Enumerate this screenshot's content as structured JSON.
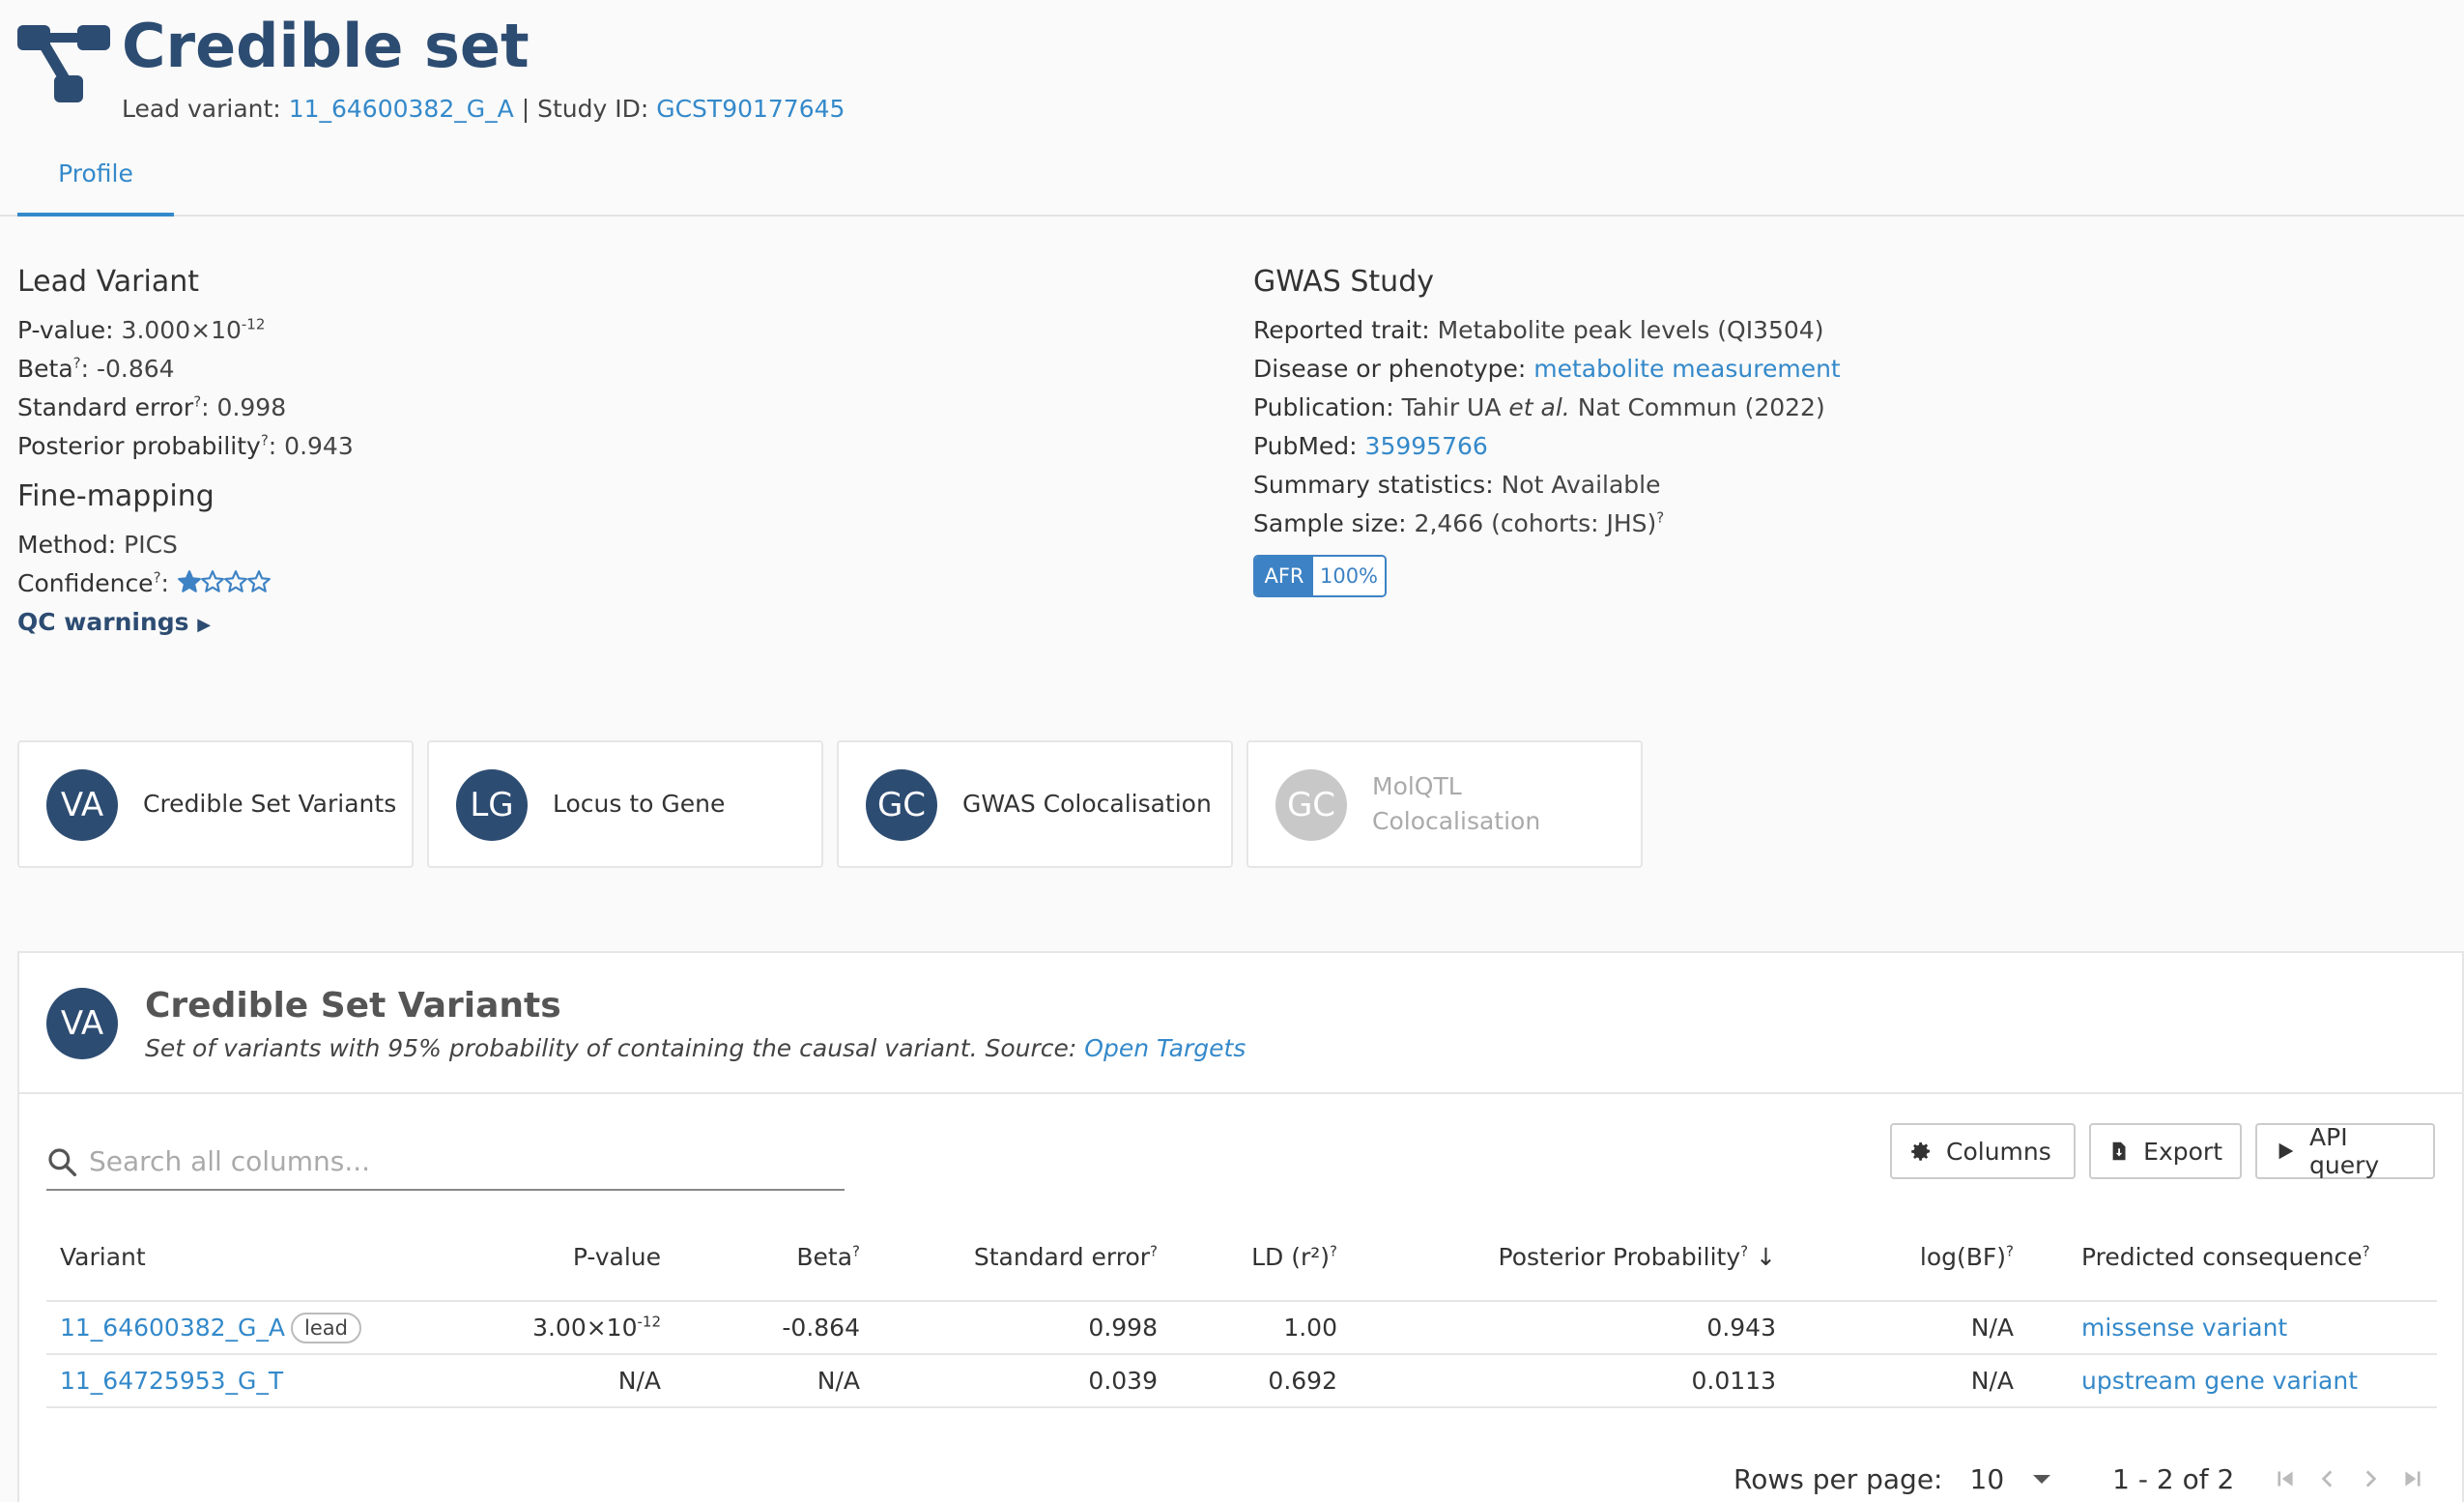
{
  "header": {
    "title": "Credible set",
    "lead_variant_label": "Lead variant:",
    "lead_variant": "11_64600382_G_A",
    "study_id_label": "Study ID:",
    "study_id": "GCST90177645"
  },
  "tabs": [
    {
      "label": "Profile"
    }
  ],
  "lead_variant_section": {
    "title": "Lead Variant",
    "pvalue_label": "P-value:",
    "pvalue_mantissa": "3.000×10",
    "pvalue_exponent": "-12",
    "beta_label": "Beta",
    "beta": "-0.864",
    "se_label": "Standard error",
    "se": "0.998",
    "pp_label": "Posterior probability",
    "pp": "0.943"
  },
  "finemapping": {
    "title": "Fine-mapping",
    "method_label": "Method:",
    "method": "PICS",
    "confidence_label": "Confidence",
    "confidence_stars": 1,
    "confidence_max": 4,
    "qc_label": "QC warnings"
  },
  "gwas": {
    "title": "GWAS Study",
    "trait_label": "Reported trait:",
    "trait": "Metabolite peak levels (QI3504)",
    "disease_label": "Disease or phenotype:",
    "disease": "metabolite measurement",
    "publication_label": "Publication:",
    "publication_author": "Tahir UA",
    "publication_etal": "et al.",
    "publication_rest": "Nat Commun (2022)",
    "pubmed_label": "PubMed:",
    "pubmed": "35995766",
    "sumstats_label": "Summary statistics:",
    "sumstats": "Not Available",
    "sample_size_label": "Sample size:",
    "sample_size": "2,466 (cohorts: JHS)",
    "ancestry": "AFR",
    "ancestry_pct": "100%"
  },
  "cards": [
    {
      "abbr": "VA",
      "label": "Credible Set Variants",
      "enabled": true
    },
    {
      "abbr": "LG",
      "label": "Locus to Gene",
      "enabled": true
    },
    {
      "abbr": "GC",
      "label": "GWAS Colocalisation",
      "enabled": true
    },
    {
      "abbr": "GC",
      "label": "MolQTL Colocalisation",
      "enabled": false
    }
  ],
  "widget": {
    "abbr": "VA",
    "title": "Credible Set Variants",
    "description": "Set of variants with 95% probability of containing the causal variant. Source:",
    "source": "Open Targets",
    "search_placeholder": "Search all columns...",
    "columns_button": "Columns",
    "export_button": "Export",
    "api_button": "API query",
    "table": {
      "headers": [
        "Variant",
        "P-value",
        "Beta",
        "Standard error",
        "LD (r²)",
        "Posterior Probability",
        "log(BF)",
        "Predicted consequence"
      ],
      "rows": [
        {
          "variant": "11_64600382_G_A",
          "lead": "lead",
          "pvalue_mantissa": "3.00×10",
          "pvalue_exponent": "-12",
          "beta": "-0.864",
          "se": "0.998",
          "ld": "1.00",
          "pp": "0.943",
          "logbf": "N/A",
          "consequence": "missense variant"
        },
        {
          "variant": "11_64725953_G_T",
          "lead": "",
          "pvalue_mantissa": "N/A",
          "pvalue_exponent": "",
          "beta": "N/A",
          "se": "0.039",
          "ld": "0.692",
          "pp": "0.0113",
          "logbf": "N/A",
          "consequence": "upstream gene variant"
        }
      ]
    },
    "pager": {
      "rows_per_page_label": "Rows per page:",
      "rows_per_page": "10",
      "range": "1 - 2 of 2"
    }
  },
  "colors": {
    "brand": "#2d4c72",
    "link": "#3489ca",
    "star": "#3d82c4"
  },
  "icons": {
    "logo": "credible-set-icon",
    "search": "search-icon",
    "columns": "gear-icon",
    "export": "file-export-icon",
    "api": "play-icon"
  }
}
